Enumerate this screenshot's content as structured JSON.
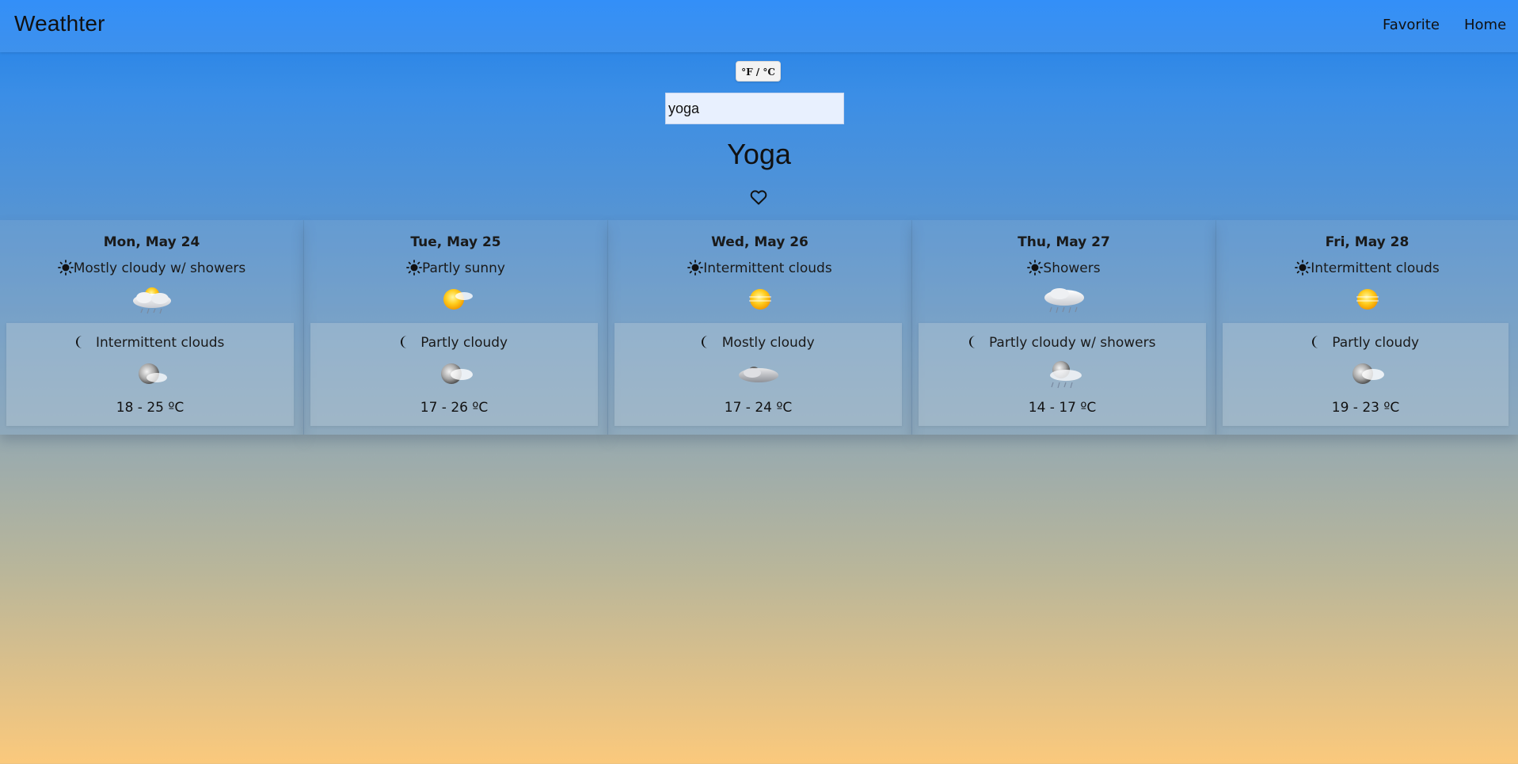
{
  "navbar": {
    "brand": "Weathter",
    "links": [
      "Favorite",
      "Home"
    ]
  },
  "unit_toggle": "°F / °C",
  "search": {
    "value": "yoga",
    "placeholder": ""
  },
  "city": "Yoga",
  "forecast": [
    {
      "date": "Mon, May 24",
      "day_condition": "Mostly cloudy w/ showers",
      "day_icon": "cloud-sun-showers-icon",
      "night_condition": "Intermittent clouds",
      "night_icon": "moon-cloud-icon",
      "temp": "18 - 25 ºC"
    },
    {
      "date": "Tue, May 25",
      "day_condition": "Partly sunny",
      "day_icon": "sun-cloud-icon",
      "night_condition": "Partly cloudy",
      "night_icon": "moon-cloud-icon",
      "temp": "17 - 26 ºC"
    },
    {
      "date": "Wed, May 26",
      "day_condition": "Intermittent clouds",
      "day_icon": "sun-haze-icon",
      "night_condition": "Mostly cloudy",
      "night_icon": "clouds-icon",
      "temp": "17 - 24 ºC"
    },
    {
      "date": "Thu, May 27",
      "day_condition": "Showers",
      "day_icon": "cloud-showers-icon",
      "night_condition": "Partly cloudy w/ showers",
      "night_icon": "moon-cloud-showers-icon",
      "temp": "14 - 17 ºC"
    },
    {
      "date": "Fri, May 28",
      "day_condition": "Intermittent clouds",
      "day_icon": "sun-haze-icon",
      "night_condition": "Partly cloudy",
      "night_icon": "moon-cloud-icon",
      "temp": "19 - 23 ºC"
    }
  ]
}
